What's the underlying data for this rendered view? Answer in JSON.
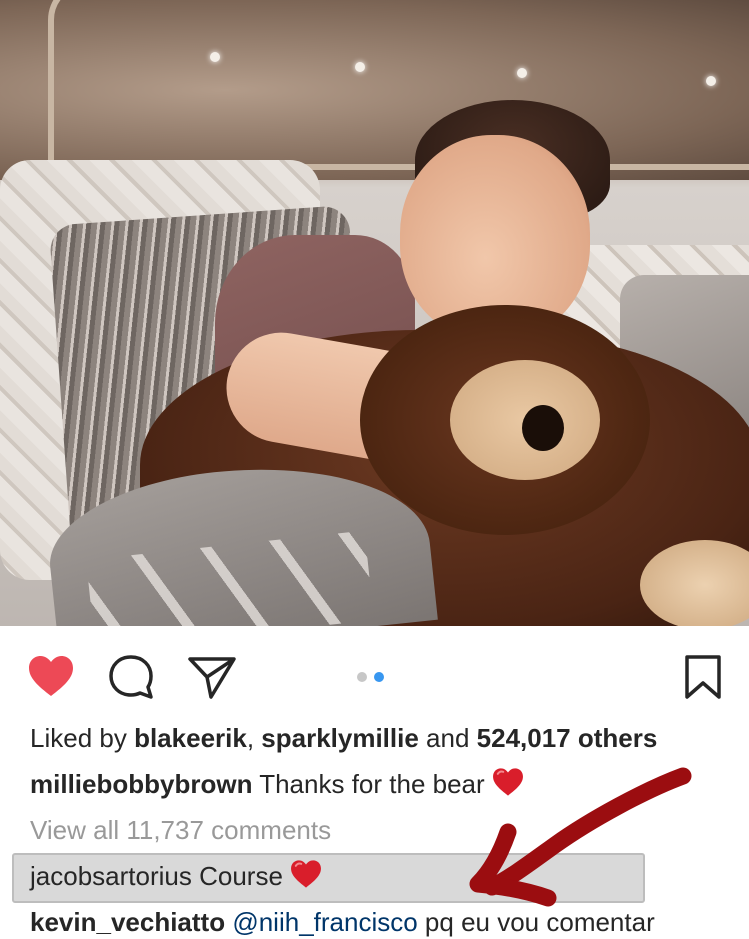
{
  "post": {
    "image_alt": "Photo of a smiling girl hugging a large brown teddy bear on a bed",
    "carousel": {
      "total": 2,
      "active_index": 1
    },
    "liked": true
  },
  "likes": {
    "prefix": "Liked by ",
    "user1": "blakeerik",
    "sep": ", ",
    "user2": "sparklymillie",
    "and": " and ",
    "others": "524,017 others"
  },
  "caption": {
    "username": "milliebobbybrown",
    "text": " Thanks for the bear"
  },
  "comments_link": "View all 11,737 comments",
  "comments": [
    {
      "username": "jacobsartorius",
      "text": " Course",
      "highlighted": true
    },
    {
      "username": "kevin_vechiatto",
      "mention": "@niih_francisco",
      "text": " pq eu vou comentar"
    }
  ],
  "colors": {
    "like_red": "#ed4956",
    "dot_active": "#3897f0",
    "dot_inactive": "#c7c7c7",
    "annotation_arrow": "#9b0d10"
  },
  "icons": [
    "heart-icon",
    "comment-icon",
    "share-icon",
    "bookmark-icon"
  ]
}
